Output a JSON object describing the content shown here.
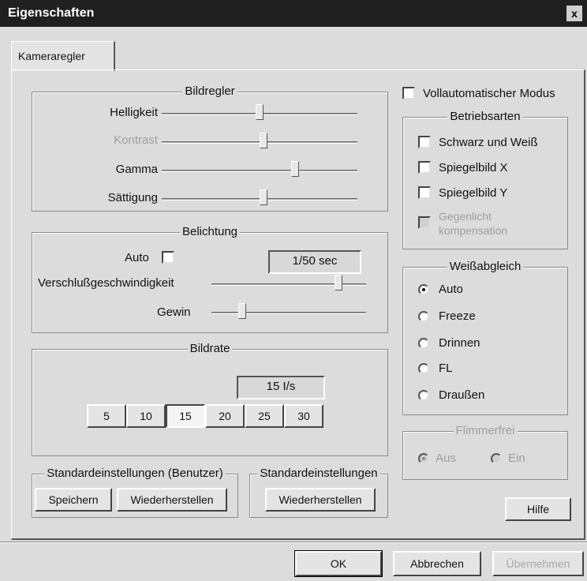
{
  "window": {
    "title": "Eigenschaften",
    "close": "x"
  },
  "tab": {
    "label": "Kameraregler"
  },
  "bildregler": {
    "title": "Bildregler",
    "sliders": [
      {
        "label": "Helligkeit",
        "value": 0.5,
        "enabled": true
      },
      {
        "label": "Kontrast",
        "value": 0.52,
        "enabled": false
      },
      {
        "label": "Gamma",
        "value": 0.68,
        "enabled": true
      },
      {
        "label": "Sättigung",
        "value": 0.52,
        "enabled": true
      }
    ]
  },
  "belichtung": {
    "title": "Belichtung",
    "auto_label": "Auto",
    "auto_checked": false,
    "shutter_value": "1/50 sec",
    "shutter_label": "Verschlußgeschwindigkeit",
    "shutter_level": 0.82,
    "gain_label": "Gewin",
    "gain_level": 0.08
  },
  "bildrate": {
    "title": "Bildrate",
    "value": "15 I/s",
    "options": [
      "5",
      "10",
      "15",
      "20",
      "25",
      "30"
    ],
    "selected": "15"
  },
  "user_defaults": {
    "title": "Standardeinstellungen (Benutzer)",
    "save": "Speichern",
    "restore": "Wiederherstellen"
  },
  "std_defaults": {
    "title": "Standardeinstellungen",
    "restore": "Wiederherstellen"
  },
  "auto_mode": {
    "label": "Vollautomatischer Modus",
    "checked": false
  },
  "betriebsarten": {
    "title": "Betriebsarten",
    "items": [
      {
        "label": "Schwarz und Weiß",
        "enabled": true
      },
      {
        "label": "Spiegelbild X",
        "enabled": true
      },
      {
        "label": "Spiegelbild Y",
        "enabled": true
      },
      {
        "label": "Gegenlicht",
        "label2": "kompensation",
        "enabled": false
      }
    ]
  },
  "weissabgleich": {
    "title": "Weißabgleich",
    "options": [
      "Auto",
      "Freeze",
      "Drinnen",
      "FL",
      "Draußen"
    ],
    "selected": "Auto"
  },
  "flimmerfrei": {
    "title": "Flimmerfrei",
    "off": "Aus",
    "on": "Ein",
    "selected": "Aus"
  },
  "help_button": "Hilfe",
  "footer": {
    "ok": "OK",
    "cancel": "Abbrechen",
    "apply": "Übernehmen"
  }
}
